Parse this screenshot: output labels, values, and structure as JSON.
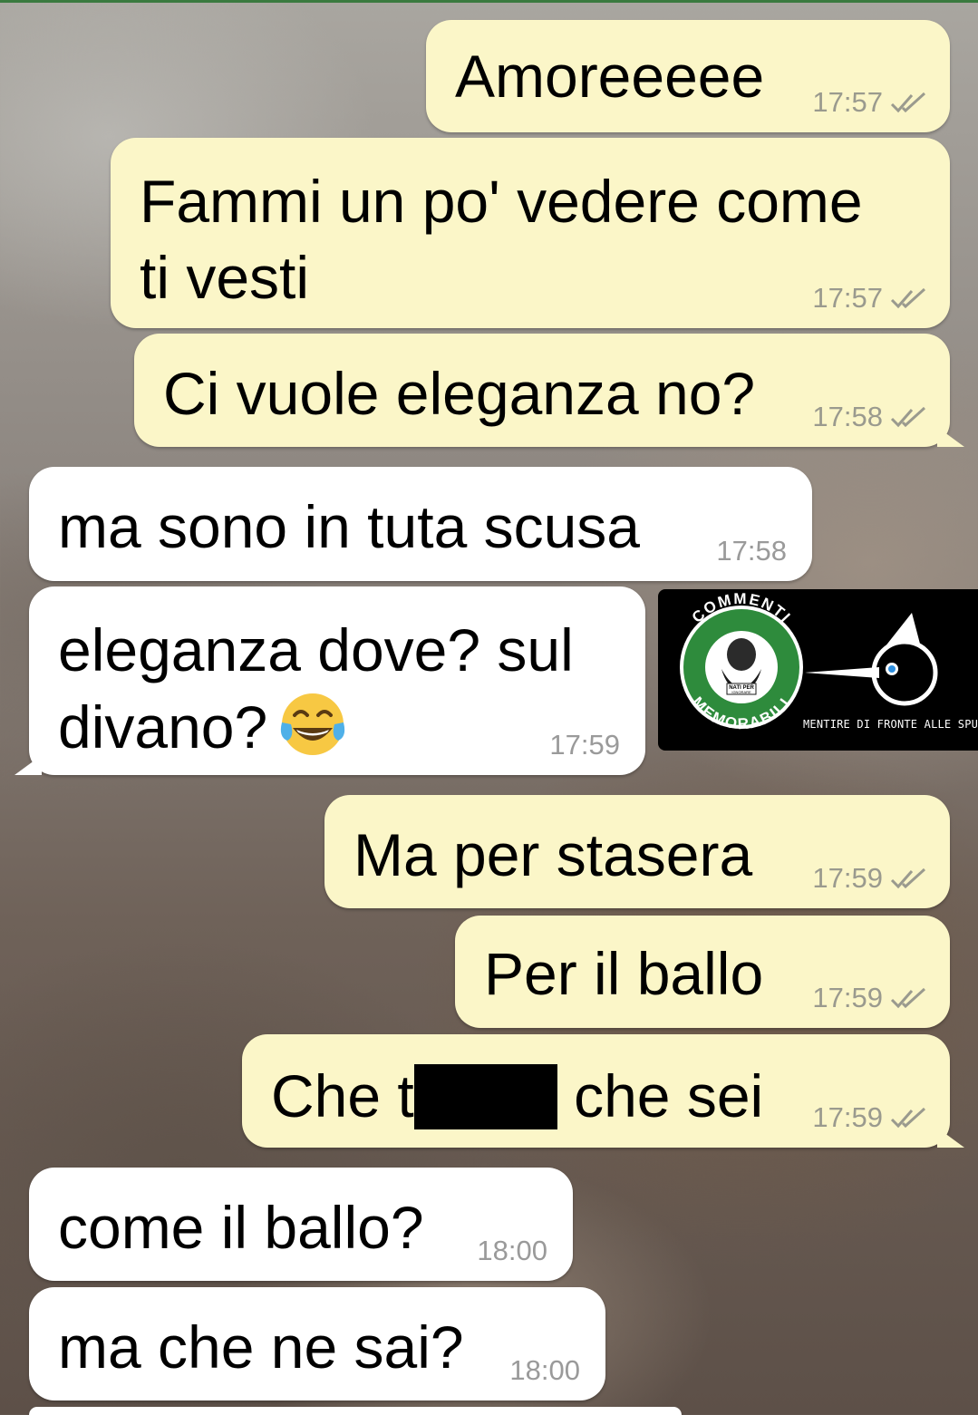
{
  "messages": [
    {
      "text": "Amoreeeee",
      "time": "17:57",
      "direction": "outgoing",
      "status": "read"
    },
    {
      "text": "Fammi un po' vedere come\nti vesti",
      "time": "17:57",
      "direction": "outgoing",
      "status": "read"
    },
    {
      "text": "Ci vuole eleganza no?",
      "time": "17:58",
      "direction": "outgoing",
      "status": "read"
    },
    {
      "text": "ma sono in tuta scusa",
      "time": "17:58",
      "direction": "incoming"
    },
    {
      "text_line1": "eleganza dove? sul",
      "text_line2": "divano?",
      "emoji": "face-with-tears-of-joy",
      "time": "17:59",
      "direction": "incoming"
    },
    {
      "text": "Ma per stasera",
      "time": "17:59",
      "direction": "outgoing",
      "status": "read"
    },
    {
      "text": "Per il ballo",
      "time": "17:59",
      "direction": "outgoing",
      "status": "read"
    },
    {
      "text_before": "Che t",
      "text_after": "che sei",
      "redacted": true,
      "time": "17:59",
      "direction": "outgoing",
      "status": "read"
    },
    {
      "text": "come il ballo?",
      "time": "18:00",
      "direction": "incoming"
    },
    {
      "text": "ma che ne sai?",
      "time": "18:00",
      "direction": "incoming"
    }
  ],
  "watermark": {
    "logo_ring_top": "COMMENTI",
    "logo_ring_bottom": "MEMORABILI",
    "logo_center": "NATI PER IGNORARE",
    "caption": "MENTIRE DI FRONTE ALLE SPUNTE BLU"
  },
  "colors": {
    "outgoing_bubble": "#fbf6c8",
    "incoming_bubble": "#ffffff",
    "tick": "#9a9a8e",
    "logo_green": "#2e8b3c"
  }
}
